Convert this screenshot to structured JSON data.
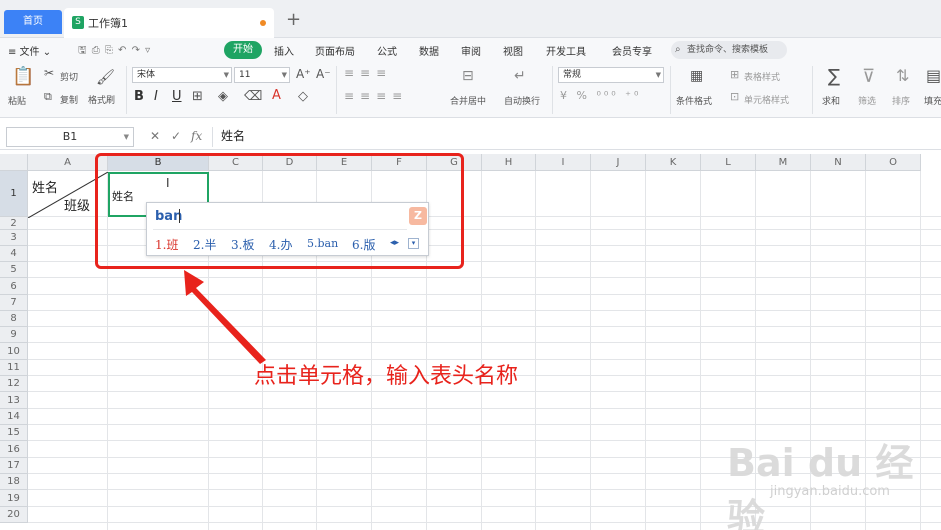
{
  "tabs": {
    "home": "首页",
    "document": "工作簿1",
    "new": "+"
  },
  "menu": {
    "file": "≡ 文件 ⌄",
    "quick_icons": "🖫  ⎙  ⎘  ↶  ↷  ▿",
    "items": [
      "开始",
      "插入",
      "页面布局",
      "公式",
      "数据",
      "审阅",
      "视图",
      "开发工具",
      "会员专享"
    ],
    "search_placeholder": "查找命令、搜索模板"
  },
  "toolbar": {
    "paste": "粘贴",
    "cut": "剪切",
    "copy": "复制",
    "format_painter": "格式刷",
    "font_name": "宋体",
    "font_size": "11",
    "merge_center": "合并居中",
    "wrap_text": "自动换行",
    "number_format": "常规",
    "conditional_format": "条件格式",
    "table_style": "表格样式",
    "cell_style": "单元格样式",
    "sum": "求和",
    "filter": "筛选",
    "sort": "排序",
    "fill": "填充"
  },
  "formula_bar": {
    "cell_ref": "B1",
    "cancel": "✕",
    "confirm": "✓",
    "fx": "fx",
    "content": "姓名"
  },
  "columns": [
    "A",
    "B",
    "C",
    "D",
    "E",
    "F",
    "G",
    "H",
    "I",
    "J",
    "K",
    "L",
    "M",
    "N",
    "O"
  ],
  "selected_column": "B",
  "rows": [
    "1",
    "2",
    "3",
    "4",
    "5",
    "6",
    "7",
    "8",
    "9",
    "10",
    "11",
    "12",
    "13",
    "14",
    "15",
    "16",
    "17",
    "18",
    "19",
    "20"
  ],
  "selected_row": "1",
  "cells": {
    "a1_top": "姓名",
    "a1_bottom": "班级",
    "b1": "姓名"
  },
  "ime": {
    "composition": "ban",
    "candidates": [
      "1.班",
      "2.半",
      "3.板",
      "4.办",
      "5.ban",
      "6.版"
    ],
    "nav": "◂▸",
    "more": "▾",
    "logo": "Z"
  },
  "annotation": "点击单元格，输入表头名称",
  "watermark": {
    "logo": "Bai du 经验",
    "url": "jingyan.baidu.com"
  },
  "colors": {
    "accent": "#1fa463",
    "annotation": "#e8231c",
    "tab_blue": "#3c82f6"
  }
}
